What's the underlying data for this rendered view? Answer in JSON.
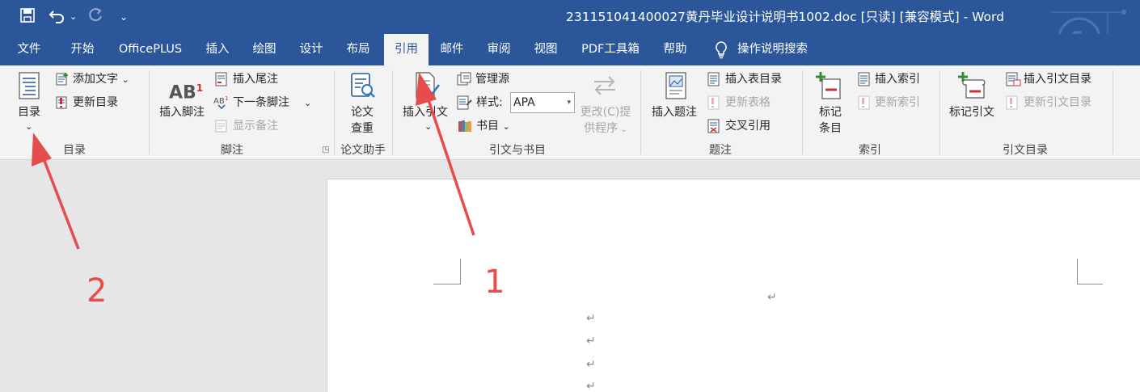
{
  "window": {
    "title": "231151041400027黄丹毕业设计说明书1002.doc [只读] [兼容模式]  -  Word"
  },
  "colors": {
    "accent": "#2b579a",
    "annotation": "#e74c4c"
  },
  "tabs": [
    {
      "label": "文件"
    },
    {
      "label": "开始"
    },
    {
      "label": "OfficePLUS"
    },
    {
      "label": "插入"
    },
    {
      "label": "绘图"
    },
    {
      "label": "设计"
    },
    {
      "label": "布局"
    },
    {
      "label": "引用"
    },
    {
      "label": "邮件"
    },
    {
      "label": "审阅"
    },
    {
      "label": "视图"
    },
    {
      "label": "PDF工具箱"
    },
    {
      "label": "帮助"
    }
  ],
  "search_label": "操作说明搜索",
  "ribbon": {
    "toc": {
      "btn": "目录",
      "add_text": "添加文字",
      "update": "更新目录",
      "group": "目录"
    },
    "footnote": {
      "insert": "插入脚注",
      "insert_endnote": "插入尾注",
      "next": "下一条脚注",
      "show": "显示备注",
      "group": "脚注"
    },
    "paper": {
      "btn_line1": "论文",
      "btn_line2": "查重",
      "group": "论文助手"
    },
    "citation": {
      "insert": "插入引文",
      "manage": "管理源",
      "style_label": "样式:",
      "style_value": "APA",
      "biblio": "书目",
      "update_line1": "更改(C)提",
      "update_line2": "供程序",
      "group": "引文与书目"
    },
    "caption": {
      "insert": "插入题注",
      "insert_table": "插入表目录",
      "update_table": "更新表格",
      "cross_ref": "交叉引用",
      "group": "题注"
    },
    "index": {
      "mark_line1": "标记",
      "mark_line2": "条目",
      "insert": "插入索引",
      "update": "更新索引",
      "group": "索引"
    },
    "toa": {
      "mark": "标记引文",
      "insert": "插入引文目录",
      "update": "更新引文目录",
      "group": "引文目录"
    }
  },
  "annotations": {
    "one": "1",
    "two": "2"
  },
  "document": {
    "para_mark": "↵"
  }
}
